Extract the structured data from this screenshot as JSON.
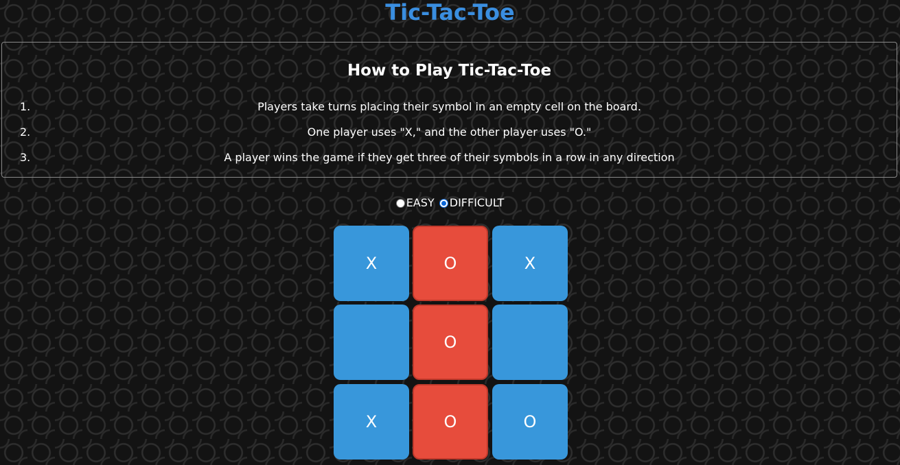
{
  "title": "Tic-Tac-Toe",
  "rules": {
    "heading": "How to Play Tic-Tac-Toe",
    "items": [
      {
        "num": "1.",
        "text": "Players take turns placing their symbol in an empty cell on the board."
      },
      {
        "num": "2.",
        "text": "One player uses \"X,\" and the other player uses \"O.\""
      },
      {
        "num": "3.",
        "text": "A player wins the game if they get three of their symbols in a row in any direction"
      }
    ]
  },
  "difficulty": {
    "options": [
      "EASY",
      "DIFFICULT"
    ],
    "selected": "DIFFICULT"
  },
  "board": {
    "cells": [
      "X",
      "O",
      "X",
      "",
      "O",
      "",
      "X",
      "O",
      "O"
    ],
    "winning_line": [
      1,
      4,
      7
    ],
    "colors": {
      "cell": "#3897db",
      "winning_cell": "#e74c3c",
      "winning_border": "#c0392b",
      "title": "#3a8ee0"
    }
  }
}
